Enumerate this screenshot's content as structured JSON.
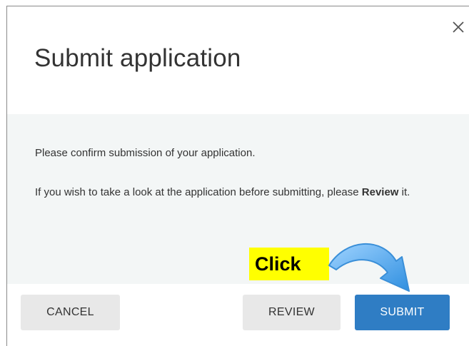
{
  "dialog": {
    "title": "Submit application",
    "close_icon": "close-icon",
    "message_line1": "Please confirm submission of your application.",
    "message_line2_part1": "If you wish to take a look at the application before submitting, please ",
    "message_line2_bold": "Review",
    "message_line2_part2": " it."
  },
  "buttons": {
    "cancel": "CANCEL",
    "review": "REVIEW",
    "submit": "SUBMIT"
  },
  "annotation": {
    "label": "Click",
    "arrow_icon": "curved-arrow-icon"
  },
  "colors": {
    "submit_bg": "#2f7dc4",
    "secondary_bg": "#e8e8e8",
    "body_bg": "#f3f6f6",
    "annotation_bg": "#ffff00",
    "arrow": "#4aa3e8"
  }
}
